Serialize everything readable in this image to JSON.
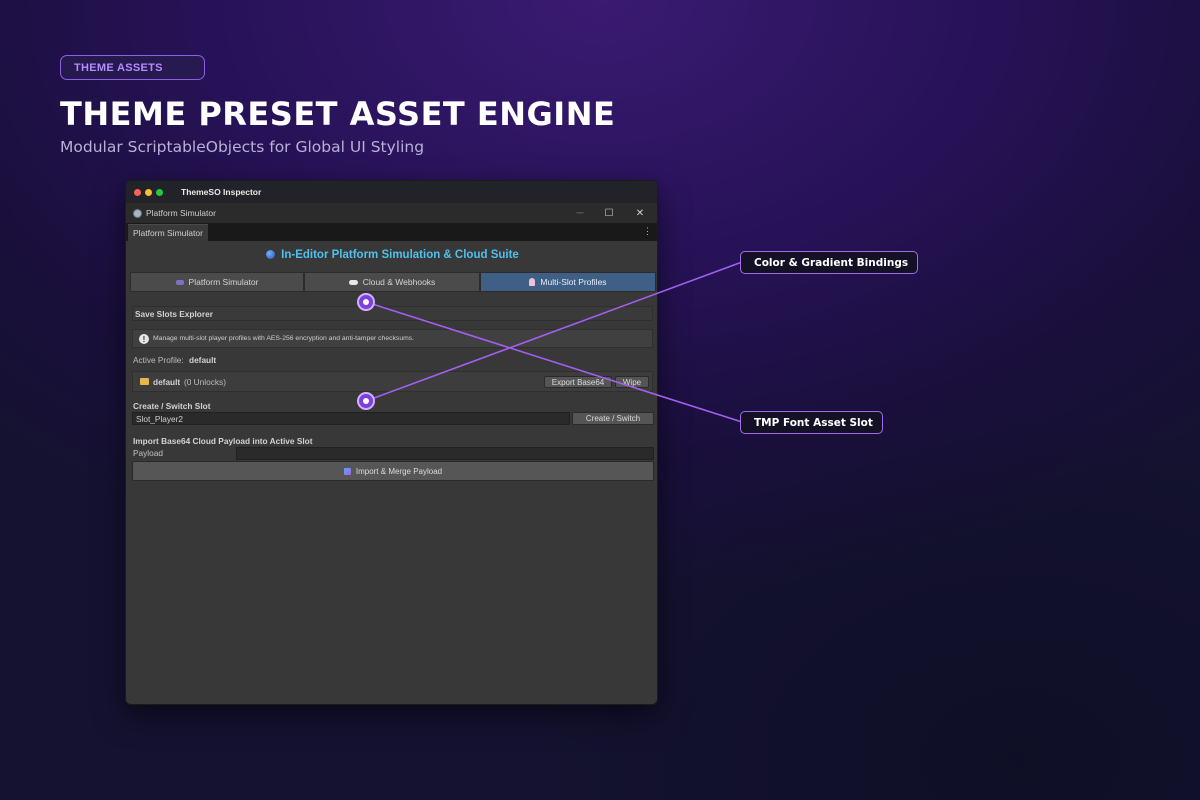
{
  "badge": "THEME ASSETS",
  "hero": {
    "title": "THEME PRESET ASSET ENGINE",
    "subtitle": "Modular ScriptableObjects for Global UI Styling"
  },
  "window": {
    "mac_title": "ThemeSO Inspector",
    "host_title": "Platform Simulator",
    "tab_label": "Platform Simulator",
    "tab_menu": "⋮",
    "controls": {
      "minimize": "─",
      "maximize": "☐",
      "close": "✕"
    },
    "header": {
      "icon": "globe-icon",
      "title": "In-Editor Platform Simulation & Cloud Suite"
    },
    "segments": [
      {
        "icon": "gamepad-icon",
        "label": "Platform Simulator",
        "active": false
      },
      {
        "icon": "cloud-icon",
        "label": "Cloud & Webhooks",
        "active": false
      },
      {
        "icon": "user-icon",
        "label": "Multi-Slot Profiles",
        "active": true
      }
    ],
    "save_slots": {
      "title": "Save Slots Explorer",
      "info": "Manage multi-slot player profiles with AES-256 encryption and anti-tamper checksums."
    },
    "active_profile": {
      "label": "Active Profile:",
      "value": "default"
    },
    "profile_row": {
      "name": "default",
      "unlocks": "(0 Unlocks)",
      "export_label": "Export Base64",
      "wipe_label": "Wipe"
    },
    "create_switch": {
      "title": "Create / Switch Slot",
      "input_value": "Slot_Player2",
      "button_label": "Create / Switch"
    },
    "import": {
      "title": "Import Base64 Cloud Payload into Active Slot",
      "payload_label": "Payload",
      "payload_value": "",
      "button_label": "Import & Merge Payload"
    }
  },
  "callouts": [
    {
      "icon": "palette-icon",
      "glyph": "",
      "label": "Color & Gradient Bindings"
    },
    {
      "icon": "font-icon",
      "glyph": "",
      "label": "TMP Font Asset Slot"
    }
  ],
  "colors": {
    "accent": "#a35ff0",
    "header_text": "#4fc1ee",
    "active_tab": "#3f5f86",
    "badge_text": "#b58cff"
  }
}
